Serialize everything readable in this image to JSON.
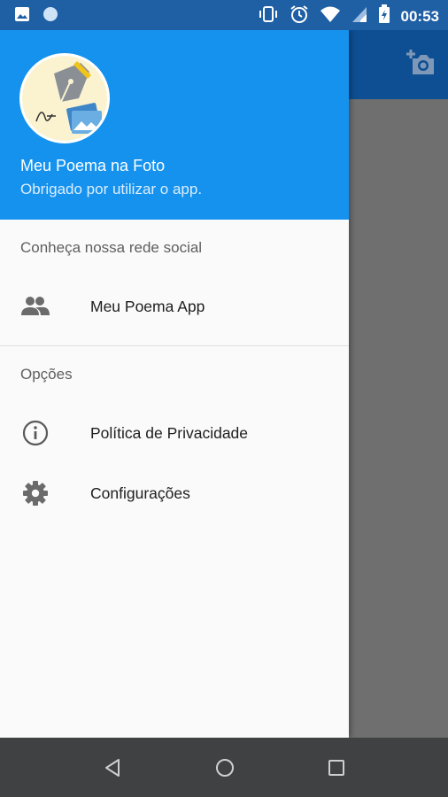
{
  "status_bar": {
    "time": "00:53",
    "icons": [
      "image-icon",
      "circle-icon",
      "vibrate-icon",
      "alarm-icon",
      "wifi-icon",
      "signal-icon",
      "battery-icon"
    ]
  },
  "app_bar": {
    "action_icon": "add-photo-icon"
  },
  "drawer": {
    "header": {
      "app_name": "Meu Poema na Foto",
      "subtitle": "Obrigado por utilizar o app."
    },
    "sections": [
      {
        "title": "Conheça nossa rede social",
        "items": [
          {
            "label": "Meu Poema App",
            "icon": "people-icon"
          }
        ]
      },
      {
        "title": "Opções",
        "items": [
          {
            "label": "Política de Privacidade",
            "icon": "info-icon"
          },
          {
            "label": "Configurações",
            "icon": "gear-icon"
          }
        ]
      }
    ]
  },
  "colors": {
    "status_bar": "#1f5fa4",
    "drawer_header": "#1592ee",
    "app_bar": "#0d4f92",
    "scrim": "#6f6f6f",
    "nav_bar": "#3f4142"
  },
  "nav_bar": {
    "buttons": [
      "back-icon",
      "home-icon",
      "recents-icon"
    ]
  }
}
